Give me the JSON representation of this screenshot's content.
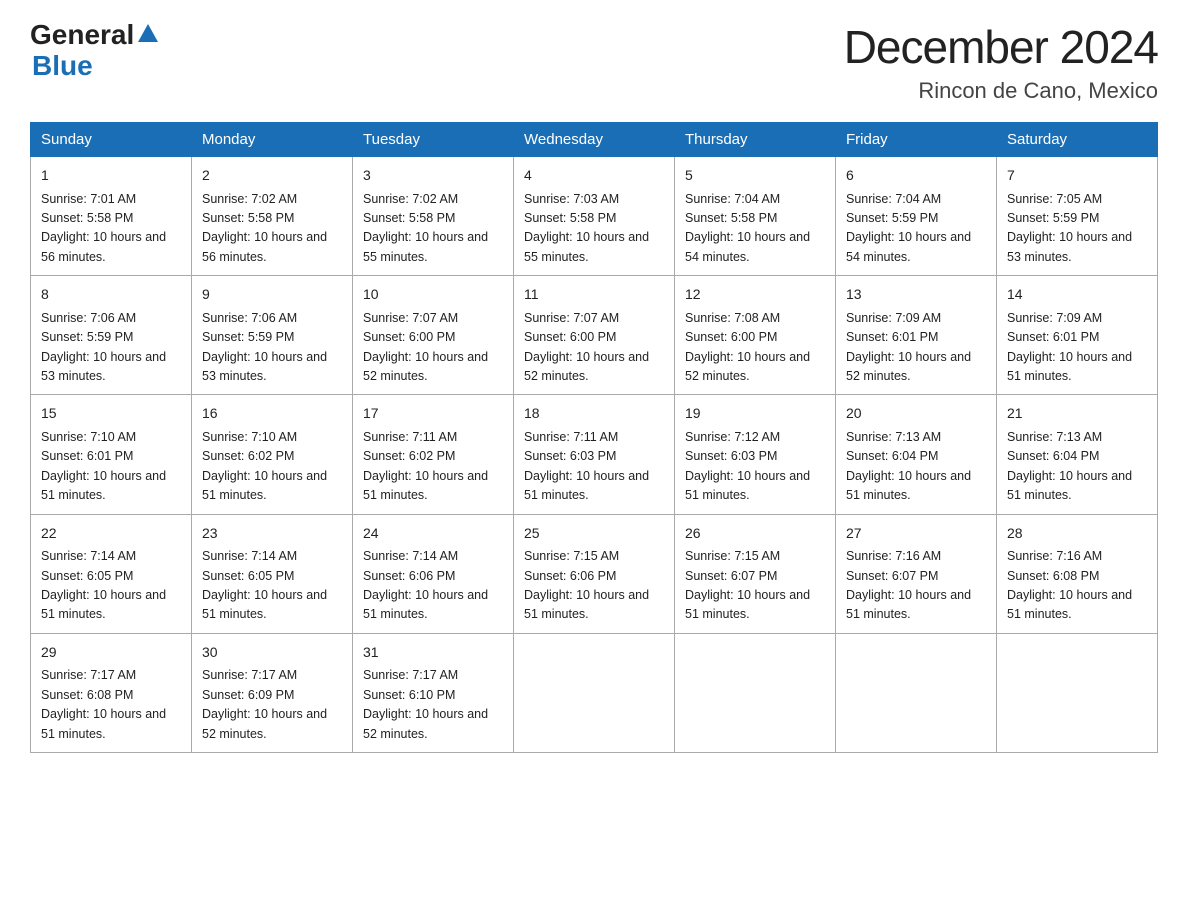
{
  "logo": {
    "general": "General",
    "blue": "Blue",
    "arrow": "▶"
  },
  "title": "December 2024",
  "subtitle": "Rincon de Cano, Mexico",
  "days_of_week": [
    "Sunday",
    "Monday",
    "Tuesday",
    "Wednesday",
    "Thursday",
    "Friday",
    "Saturday"
  ],
  "weeks": [
    [
      {
        "day": "1",
        "sunrise": "7:01 AM",
        "sunset": "5:58 PM",
        "daylight": "10 hours and 56 minutes."
      },
      {
        "day": "2",
        "sunrise": "7:02 AM",
        "sunset": "5:58 PM",
        "daylight": "10 hours and 56 minutes."
      },
      {
        "day": "3",
        "sunrise": "7:02 AM",
        "sunset": "5:58 PM",
        "daylight": "10 hours and 55 minutes."
      },
      {
        "day": "4",
        "sunrise": "7:03 AM",
        "sunset": "5:58 PM",
        "daylight": "10 hours and 55 minutes."
      },
      {
        "day": "5",
        "sunrise": "7:04 AM",
        "sunset": "5:58 PM",
        "daylight": "10 hours and 54 minutes."
      },
      {
        "day": "6",
        "sunrise": "7:04 AM",
        "sunset": "5:59 PM",
        "daylight": "10 hours and 54 minutes."
      },
      {
        "day": "7",
        "sunrise": "7:05 AM",
        "sunset": "5:59 PM",
        "daylight": "10 hours and 53 minutes."
      }
    ],
    [
      {
        "day": "8",
        "sunrise": "7:06 AM",
        "sunset": "5:59 PM",
        "daylight": "10 hours and 53 minutes."
      },
      {
        "day": "9",
        "sunrise": "7:06 AM",
        "sunset": "5:59 PM",
        "daylight": "10 hours and 53 minutes."
      },
      {
        "day": "10",
        "sunrise": "7:07 AM",
        "sunset": "6:00 PM",
        "daylight": "10 hours and 52 minutes."
      },
      {
        "day": "11",
        "sunrise": "7:07 AM",
        "sunset": "6:00 PM",
        "daylight": "10 hours and 52 minutes."
      },
      {
        "day": "12",
        "sunrise": "7:08 AM",
        "sunset": "6:00 PM",
        "daylight": "10 hours and 52 minutes."
      },
      {
        "day": "13",
        "sunrise": "7:09 AM",
        "sunset": "6:01 PM",
        "daylight": "10 hours and 52 minutes."
      },
      {
        "day": "14",
        "sunrise": "7:09 AM",
        "sunset": "6:01 PM",
        "daylight": "10 hours and 51 minutes."
      }
    ],
    [
      {
        "day": "15",
        "sunrise": "7:10 AM",
        "sunset": "6:01 PM",
        "daylight": "10 hours and 51 minutes."
      },
      {
        "day": "16",
        "sunrise": "7:10 AM",
        "sunset": "6:02 PM",
        "daylight": "10 hours and 51 minutes."
      },
      {
        "day": "17",
        "sunrise": "7:11 AM",
        "sunset": "6:02 PM",
        "daylight": "10 hours and 51 minutes."
      },
      {
        "day": "18",
        "sunrise": "7:11 AM",
        "sunset": "6:03 PM",
        "daylight": "10 hours and 51 minutes."
      },
      {
        "day": "19",
        "sunrise": "7:12 AM",
        "sunset": "6:03 PM",
        "daylight": "10 hours and 51 minutes."
      },
      {
        "day": "20",
        "sunrise": "7:13 AM",
        "sunset": "6:04 PM",
        "daylight": "10 hours and 51 minutes."
      },
      {
        "day": "21",
        "sunrise": "7:13 AM",
        "sunset": "6:04 PM",
        "daylight": "10 hours and 51 minutes."
      }
    ],
    [
      {
        "day": "22",
        "sunrise": "7:14 AM",
        "sunset": "6:05 PM",
        "daylight": "10 hours and 51 minutes."
      },
      {
        "day": "23",
        "sunrise": "7:14 AM",
        "sunset": "6:05 PM",
        "daylight": "10 hours and 51 minutes."
      },
      {
        "day": "24",
        "sunrise": "7:14 AM",
        "sunset": "6:06 PM",
        "daylight": "10 hours and 51 minutes."
      },
      {
        "day": "25",
        "sunrise": "7:15 AM",
        "sunset": "6:06 PM",
        "daylight": "10 hours and 51 minutes."
      },
      {
        "day": "26",
        "sunrise": "7:15 AM",
        "sunset": "6:07 PM",
        "daylight": "10 hours and 51 minutes."
      },
      {
        "day": "27",
        "sunrise": "7:16 AM",
        "sunset": "6:07 PM",
        "daylight": "10 hours and 51 minutes."
      },
      {
        "day": "28",
        "sunrise": "7:16 AM",
        "sunset": "6:08 PM",
        "daylight": "10 hours and 51 minutes."
      }
    ],
    [
      {
        "day": "29",
        "sunrise": "7:17 AM",
        "sunset": "6:08 PM",
        "daylight": "10 hours and 51 minutes."
      },
      {
        "day": "30",
        "sunrise": "7:17 AM",
        "sunset": "6:09 PM",
        "daylight": "10 hours and 52 minutes."
      },
      {
        "day": "31",
        "sunrise": "7:17 AM",
        "sunset": "6:10 PM",
        "daylight": "10 hours and 52 minutes."
      },
      null,
      null,
      null,
      null
    ]
  ]
}
